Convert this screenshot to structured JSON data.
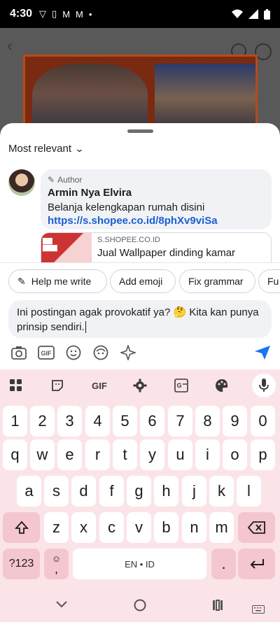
{
  "status_bar": {
    "time": "4:30"
  },
  "comments": {
    "sort_label": "Most relevant",
    "author_badge": "Author",
    "author_name": "Armin Nya Elvira",
    "comment_text": "Belanja kelengkapan rumah disini",
    "comment_link": "https://s.shopee.co.id/8phXv9viSa",
    "link_domain": "S.SHOPEE.CO.ID",
    "link_title": "Jual Wallpaper dinding kamar"
  },
  "ai_chips": [
    "Help me write",
    "Add emoji",
    "Fix grammar",
    "Fu"
  ],
  "composer": {
    "text": "Ini postingan agak provokatif ya? 🤔 Kita kan punya prinsip sendiri."
  },
  "keyboard": {
    "numbers": [
      "1",
      "2",
      "3",
      "4",
      "5",
      "6",
      "7",
      "8",
      "9",
      "0"
    ],
    "row1": [
      "q",
      "w",
      "e",
      "r",
      "t",
      "y",
      "u",
      "i",
      "o",
      "p"
    ],
    "row2": [
      "a",
      "s",
      "d",
      "f",
      "g",
      "h",
      "j",
      "k",
      "l"
    ],
    "row3": [
      "z",
      "x",
      "c",
      "v",
      "b",
      "n",
      "m"
    ],
    "symbols_key": "?123",
    "space_label": "EN • ID",
    "period_key": ".",
    "comma_key": ","
  },
  "colors": {
    "link": "#1a5fd1",
    "keyboard_bg": "#fbe4e8",
    "send": "#1877f2"
  }
}
